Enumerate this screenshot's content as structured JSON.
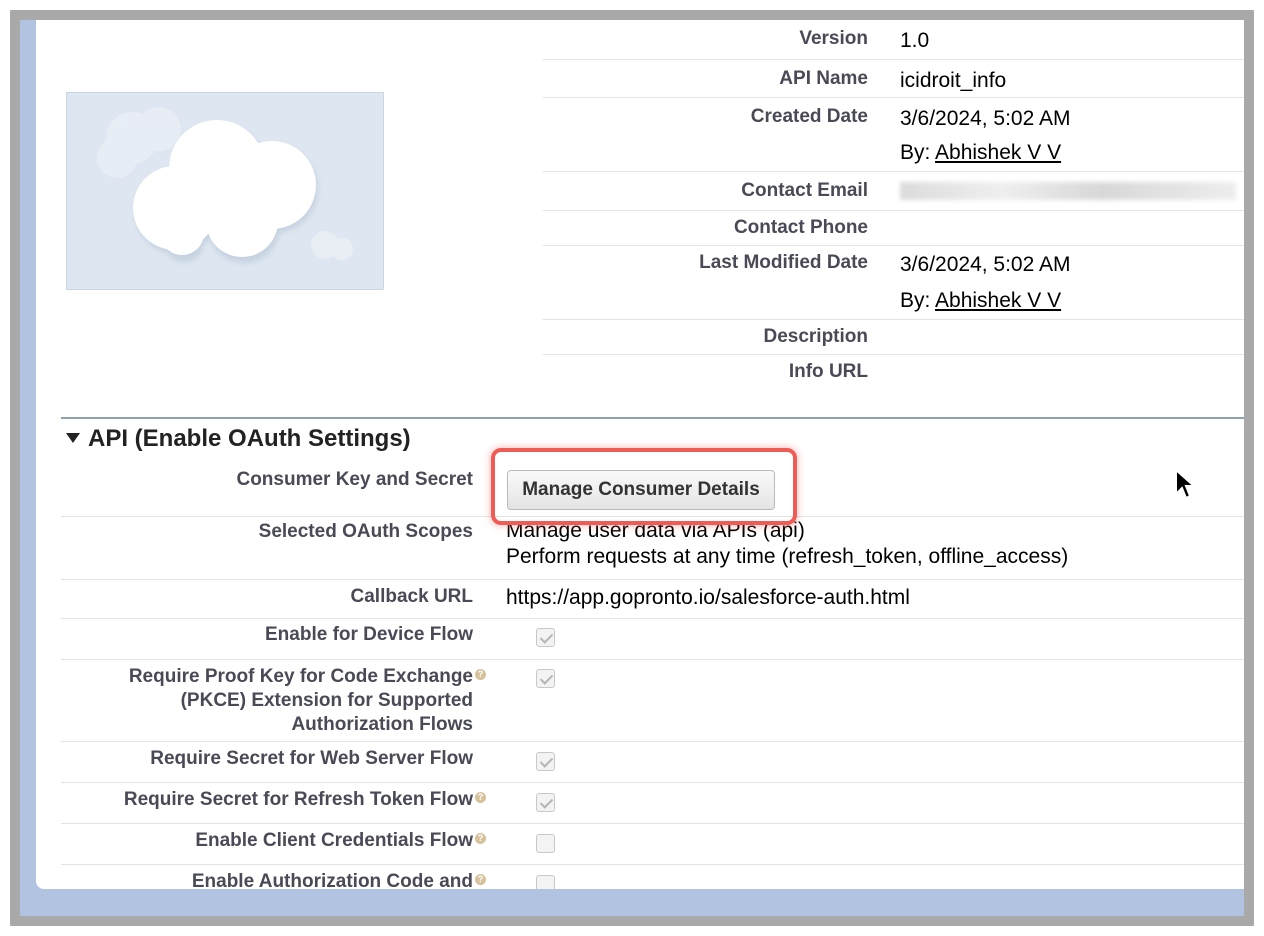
{
  "details": [
    {
      "label": "Version",
      "value": "1.0"
    },
    {
      "label": "API Name",
      "value": "icidroit_info"
    },
    {
      "label": "Created Date",
      "value": "3/6/2024, 5:02 AM"
    },
    {
      "label": "",
      "by_prefix": "By: ",
      "by_link": "Abhishek V V"
    },
    {
      "label": "Contact Email",
      "value": ""
    },
    {
      "label": "Contact Phone",
      "value": ""
    },
    {
      "label": "Last Modified Date",
      "value": "3/6/2024, 5:02 AM"
    },
    {
      "label": "",
      "by_prefix": "By: ",
      "by_link": "Abhishek V V"
    },
    {
      "label": "Description",
      "value": ""
    },
    {
      "label": "Info URL",
      "value": ""
    }
  ],
  "section": {
    "title": "API (Enable OAuth Settings)"
  },
  "oauth": {
    "consumer_key_label": "Consumer Key and Secret",
    "manage_button_label": "Manage Consumer Details",
    "scopes_label": "Selected OAuth Scopes",
    "scopes": [
      "Manage user data via APIs (api)",
      "Perform requests at any time (refresh_token, offline_access)"
    ],
    "callback_label": "Callback URL",
    "callback_value": "https://app.gopronto.io/salesforce-auth.html",
    "flags": [
      {
        "label": "Enable for Device Flow",
        "checked": true,
        "help": false
      },
      {
        "label": "Require Proof Key for Code Exchange (PKCE) Extension for Supported Authorization Flows",
        "label_lines": [
          "Require Proof Key for Code Exchange",
          "(PKCE) Extension for Supported",
          "Authorization Flows"
        ],
        "checked": true,
        "help": true
      },
      {
        "label": "Require Secret for Web Server Flow",
        "checked": true,
        "help": false
      },
      {
        "label": "Require Secret for Refresh Token Flow",
        "checked": true,
        "help": true
      },
      {
        "label": "Enable Client Credentials Flow",
        "checked": false,
        "help": true
      },
      {
        "label": "Enable Authorization Code and",
        "checked": false,
        "help": true
      }
    ],
    "help_glyph": "?"
  },
  "colors": {
    "highlight": "#ef5b55",
    "background": "#b1c3e0"
  }
}
